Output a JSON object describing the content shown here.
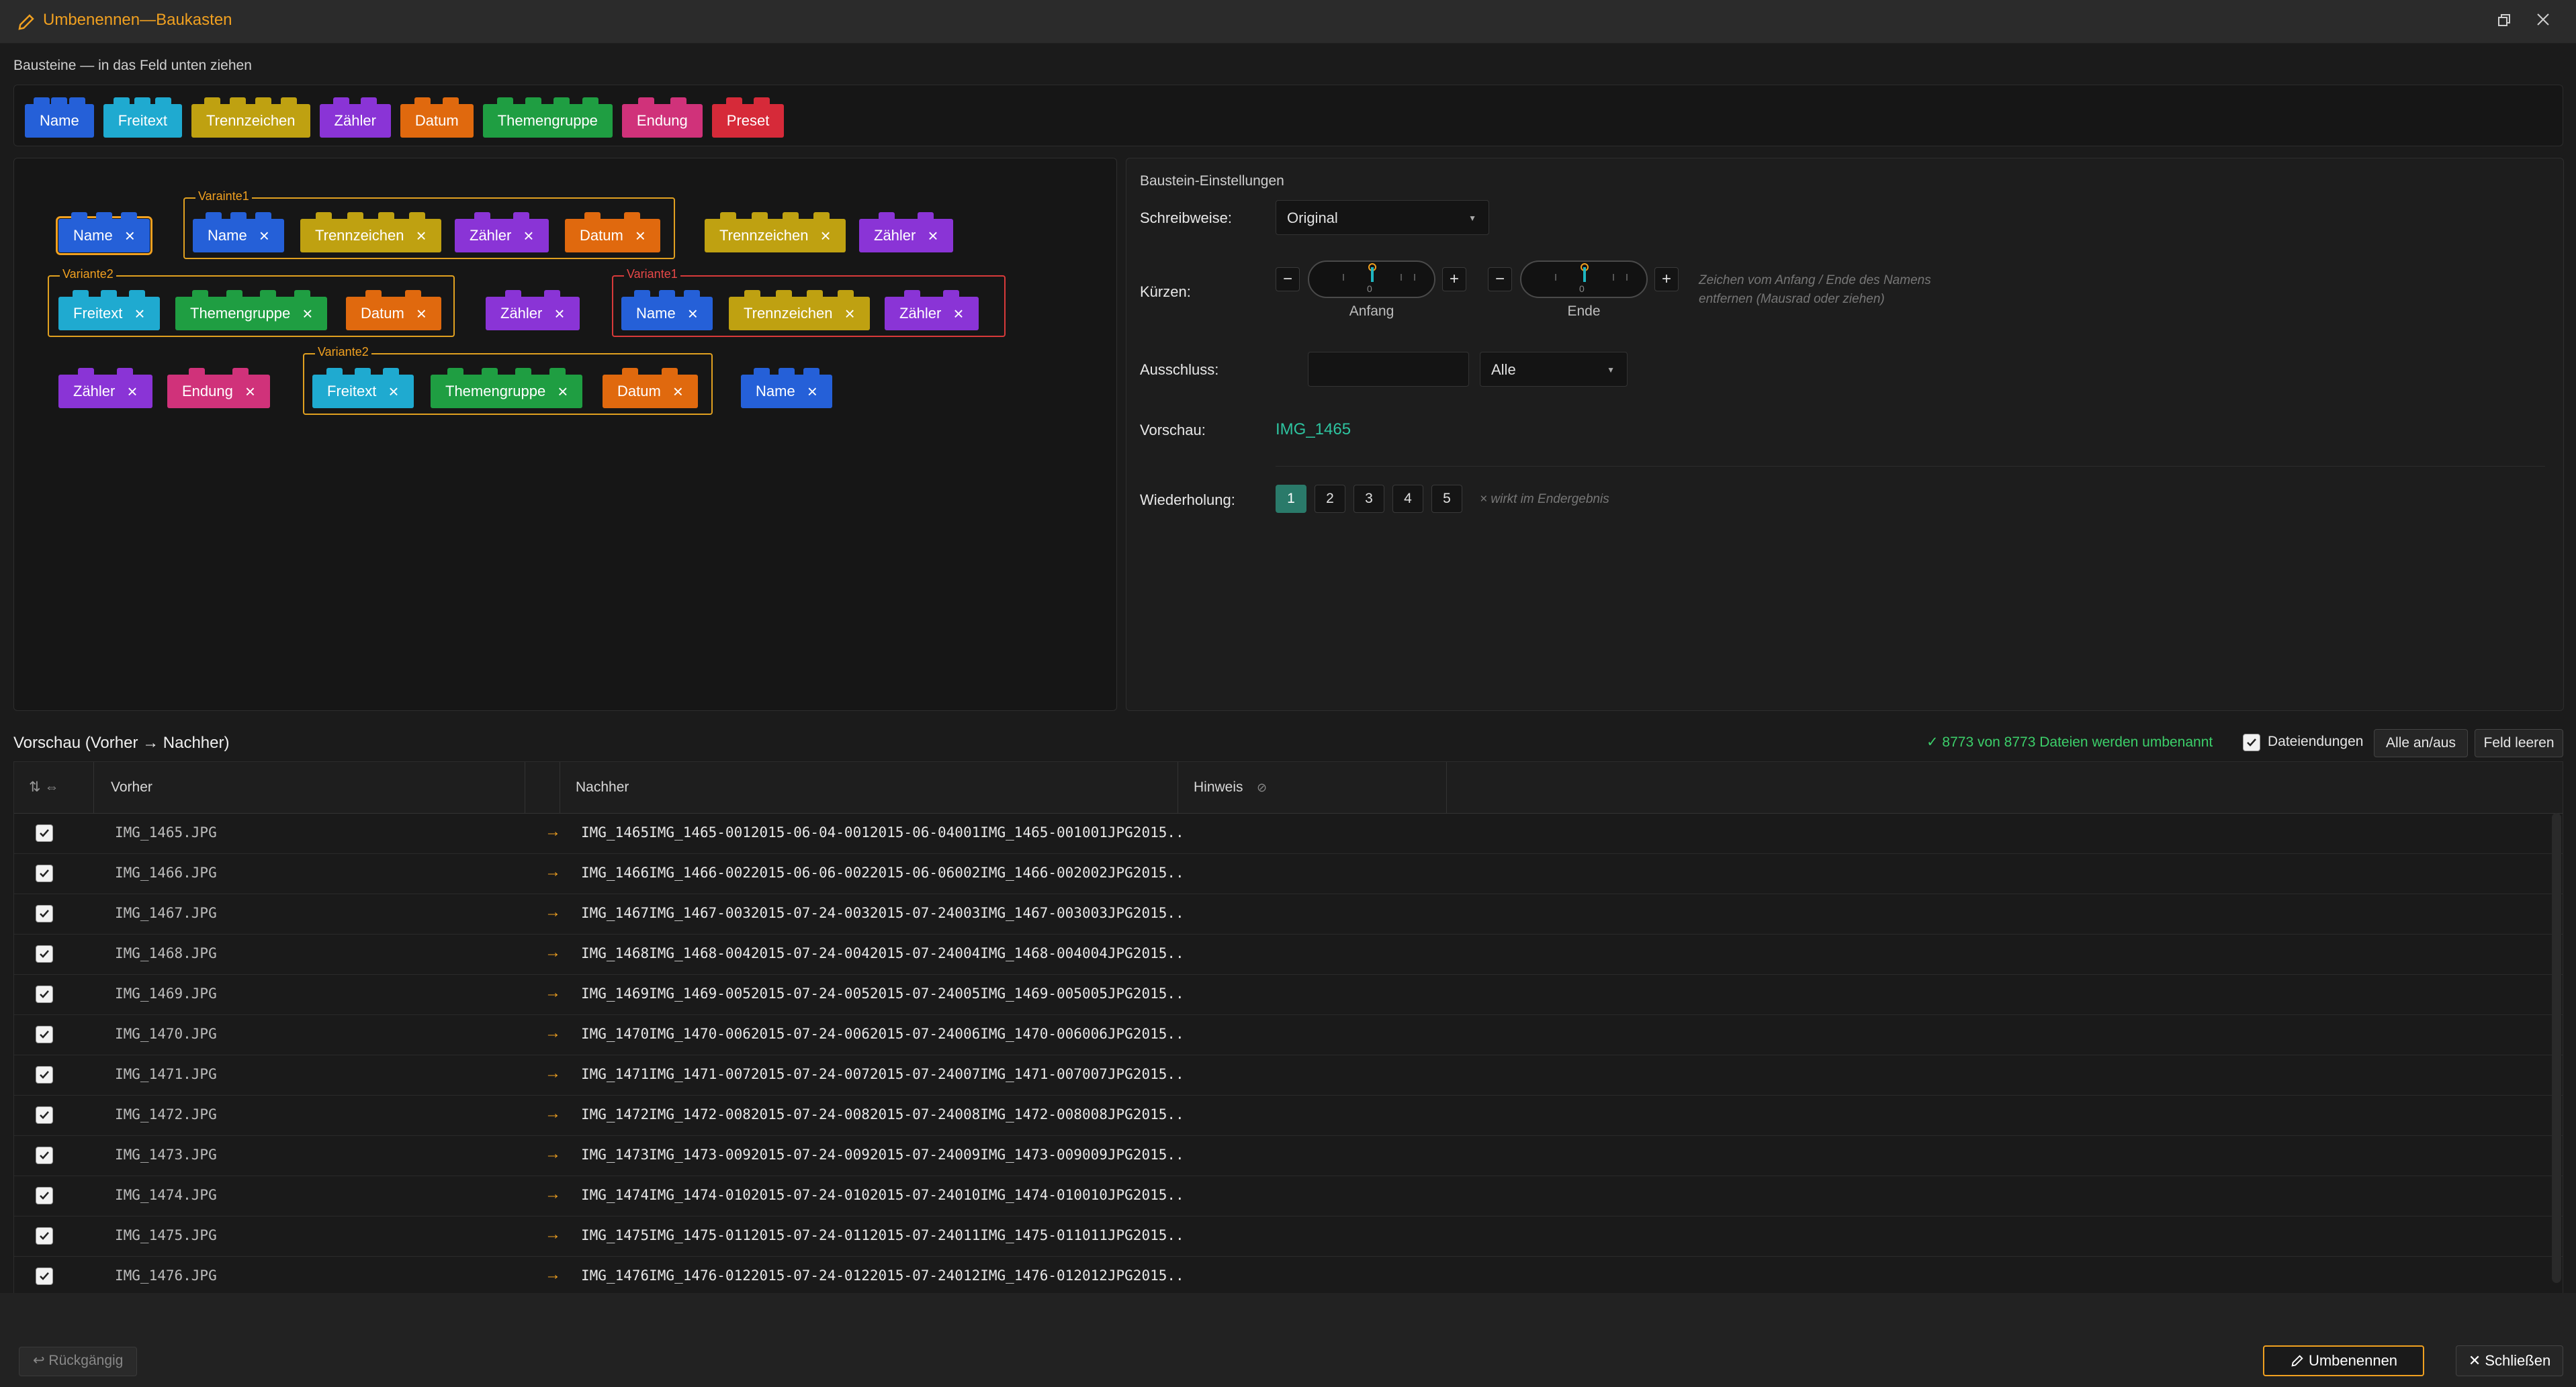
{
  "window": {
    "title": "Umbenennen—Baukasten"
  },
  "palette": {
    "label": "Bausteine — in das Feld unten ziehen",
    "items": [
      "Name",
      "Freitext",
      "Trennzeichen",
      "Zähler",
      "Datum",
      "Themengruppe",
      "Endung",
      "Preset"
    ]
  },
  "canvas": {
    "groups": [
      "Varainte1",
      "Variante2",
      "Variante1",
      "Variante2"
    ],
    "bricks": [
      "Name",
      "Name",
      "Trennzeichen",
      "Zähler",
      "Datum",
      "Trennzeichen",
      "Zähler",
      "Freitext",
      "Themengruppe",
      "Datum",
      "Zähler",
      "Name",
      "Trennzeichen",
      "Zähler",
      "Zähler",
      "Endung",
      "Freitext",
      "Themengruppe",
      "Datum",
      "Name"
    ]
  },
  "settings": {
    "title": "Baustein-Einstellungen",
    "schreibweise_label": "Schreibweise:",
    "schreibweise_value": "Original",
    "kuerzen_label": "Kürzen:",
    "anfang_label": "Anfang",
    "ende_label": "Ende",
    "anfang_value": "0",
    "ende_value": "0",
    "kuerzen_hint": "Zeichen vom Anfang / Ende des Namens",
    "kuerzen_hint2": "entfernen (Mausrad oder ziehen)",
    "ausschluss_label": "Ausschluss:",
    "ausschluss_value": "",
    "ausschluss_select": "Alle",
    "vorschau_label": "Vorschau:",
    "vorschau_value": "IMG_1465",
    "wiederholung_label": "Wiederholung:",
    "wiederholung_options": [
      "1",
      "2",
      "3",
      "4",
      "5"
    ],
    "wiederholung_selected": "1",
    "wiederholung_hint": "× wirkt im Endergebnis"
  },
  "preview": {
    "title": "Vorschau (Vorher → Nachher)",
    "status": "✓ 8773 von 8773 Dateien werden umbenannt",
    "dateiendungen_label": "Dateiendungen",
    "toggle_all": "Alle an/aus",
    "clear_field": "Feld leeren",
    "columns": {
      "vorher": "Vorher",
      "nachher": "Nachher",
      "hinweis": "Hinweis"
    },
    "rows": [
      {
        "vorher": "IMG_1465.JPG",
        "nachher": "IMG_1465IMG_1465-0012015-06-04-0012015-06-04001IMG_1465-001001JPG2015..."
      },
      {
        "vorher": "IMG_1466.JPG",
        "nachher": "IMG_1466IMG_1466-0022015-06-06-0022015-06-06002IMG_1466-002002JPG2015..."
      },
      {
        "vorher": "IMG_1467.JPG",
        "nachher": "IMG_1467IMG_1467-0032015-07-24-0032015-07-24003IMG_1467-003003JPG2015..."
      },
      {
        "vorher": "IMG_1468.JPG",
        "nachher": "IMG_1468IMG_1468-0042015-07-24-0042015-07-24004IMG_1468-004004JPG2015..."
      },
      {
        "vorher": "IMG_1469.JPG",
        "nachher": "IMG_1469IMG_1469-0052015-07-24-0052015-07-24005IMG_1469-005005JPG2015..."
      },
      {
        "vorher": "IMG_1470.JPG",
        "nachher": "IMG_1470IMG_1470-0062015-07-24-0062015-07-24006IMG_1470-006006JPG2015..."
      },
      {
        "vorher": "IMG_1471.JPG",
        "nachher": "IMG_1471IMG_1471-0072015-07-24-0072015-07-24007IMG_1471-007007JPG2015..."
      },
      {
        "vorher": "IMG_1472.JPG",
        "nachher": "IMG_1472IMG_1472-0082015-07-24-0082015-07-24008IMG_1472-008008JPG2015..."
      },
      {
        "vorher": "IMG_1473.JPG",
        "nachher": "IMG_1473IMG_1473-0092015-07-24-0092015-07-24009IMG_1473-009009JPG2015..."
      },
      {
        "vorher": "IMG_1474.JPG",
        "nachher": "IMG_1474IMG_1474-0102015-07-24-0102015-07-24010IMG_1474-010010JPG2015..."
      },
      {
        "vorher": "IMG_1475.JPG",
        "nachher": "IMG_1475IMG_1475-0112015-07-24-0112015-07-24011IMG_1475-011011JPG2015..."
      },
      {
        "vorher": "IMG_1476.JPG",
        "nachher": "IMG_1476IMG_1476-0122015-07-24-0122015-07-24012IMG_1476-012012JPG2015..."
      }
    ]
  },
  "footer": {
    "undo": "↩ Rückgängig",
    "rename": "Umbenennen",
    "close": "✕ Schließen"
  },
  "colors": {
    "accent": "#f0a020",
    "name": "#2560d8",
    "freitext": "#1faad0",
    "trennzeichen": "#bfa111",
    "zaehler": "#8a34d6",
    "datum": "#e0690e",
    "themengruppe": "#1f9e42",
    "endung": "#d0327a",
    "preset": "#d62a39",
    "success": "#3ccf6a",
    "preview": "#2ec4a0"
  }
}
